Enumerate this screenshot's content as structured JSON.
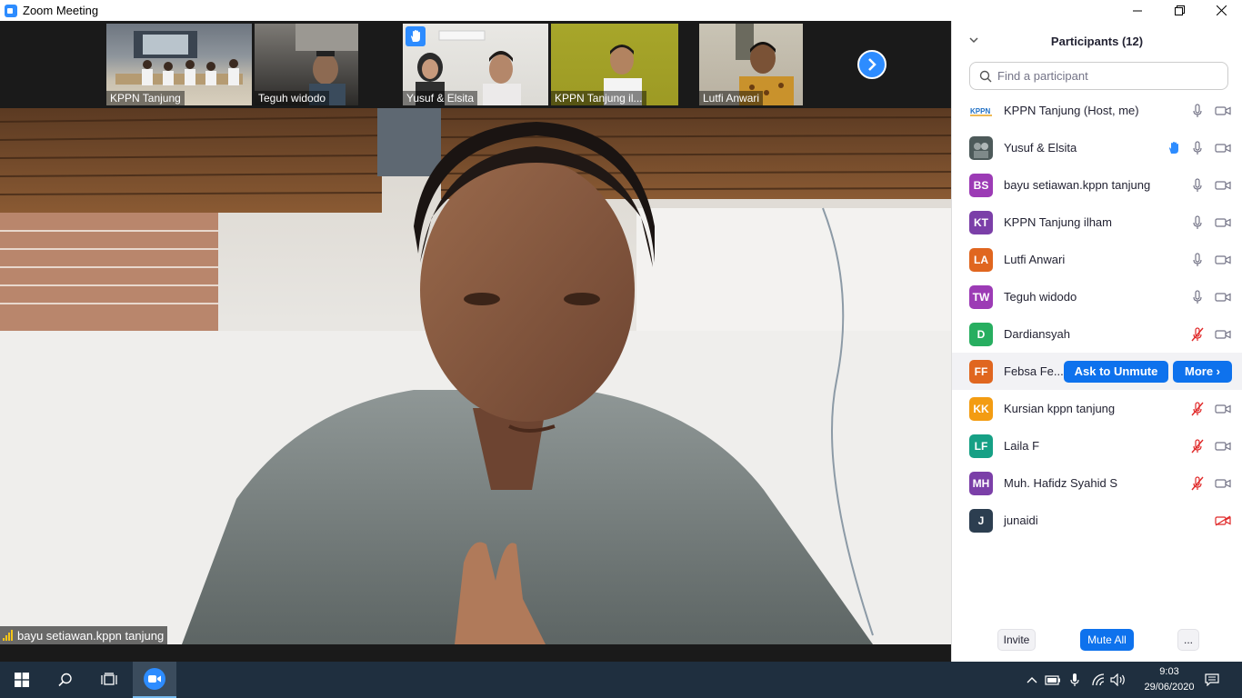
{
  "window": {
    "title": "Zoom Meeting",
    "controls": [
      "minimize",
      "restore",
      "close"
    ]
  },
  "thumbnails": [
    {
      "name": "KPPN Tanjung",
      "hand_raised": false
    },
    {
      "name": "Teguh widodo",
      "hand_raised": false
    },
    {
      "name": "Yusuf & Elsita",
      "hand_raised": true
    },
    {
      "name": "KPPN Tanjung il...",
      "hand_raised": false
    },
    {
      "name": "Lutfi Anwari",
      "hand_raised": false
    }
  ],
  "main_video": {
    "speaker_name": "bayu setiawan.kppn tanjung"
  },
  "participants_panel": {
    "title": "Participants (12)",
    "search_placeholder": "Find a participant",
    "participants": [
      {
        "initials": "",
        "name": "KPPN Tanjung (Host, me)",
        "avatar_color": "#ffffff",
        "mic": "on",
        "video": "on",
        "hand": false
      },
      {
        "initials": "",
        "name": "Yusuf & Elsita",
        "avatar_color": "#4d5a5a",
        "mic": "on",
        "video": "on",
        "hand": true
      },
      {
        "initials": "BS",
        "name": "bayu setiawan.kppn tanjung",
        "avatar_color": "#9c3bb5",
        "mic": "on",
        "video": "on",
        "hand": false
      },
      {
        "initials": "KT",
        "name": "KPPN Tanjung ilham",
        "avatar_color": "#7b3fa8",
        "mic": "on",
        "video": "on",
        "hand": false
      },
      {
        "initials": "LA",
        "name": "Lutfi Anwari",
        "avatar_color": "#e0661f",
        "mic": "on",
        "video": "on",
        "hand": false
      },
      {
        "initials": "TW",
        "name": "Teguh widodo",
        "avatar_color": "#9c3bb5",
        "mic": "on",
        "video": "on",
        "hand": false
      },
      {
        "initials": "D",
        "name": "Dardiansyah",
        "avatar_color": "#27ae60",
        "mic": "muted",
        "video": "on",
        "hand": false
      },
      {
        "initials": "FF",
        "name": "Febsa Fe...",
        "avatar_color": "#e0661f",
        "mic": "muted",
        "video": "on",
        "hand": false
      },
      {
        "initials": "KK",
        "name": "Kursian kppn tanjung",
        "avatar_color": "#f39c12",
        "mic": "muted",
        "video": "on",
        "hand": false
      },
      {
        "initials": "LF",
        "name": "Laila F",
        "avatar_color": "#16a085",
        "mic": "muted",
        "video": "on",
        "hand": false
      },
      {
        "initials": "MH",
        "name": "Muh. Hafidz Syahid S",
        "avatar_color": "#7b3fa8",
        "mic": "muted",
        "video": "on",
        "hand": false
      },
      {
        "initials": "J",
        "name": "junaidi",
        "avatar_color": "#2c3e50",
        "mic": "none",
        "video": "off",
        "hand": false
      }
    ],
    "hover_actions": {
      "ask_to_unmute": "Ask to Unmute",
      "more": "More ›"
    },
    "footer": {
      "invite": "Invite",
      "mute_all": "Mute All",
      "more": "..."
    }
  },
  "taskbar": {
    "time": "9:03",
    "date": "29/06/2020"
  },
  "colors": {
    "accent": "#0e72ed",
    "zoom_blue": "#2d8cff",
    "muted_red": "#e02828"
  }
}
